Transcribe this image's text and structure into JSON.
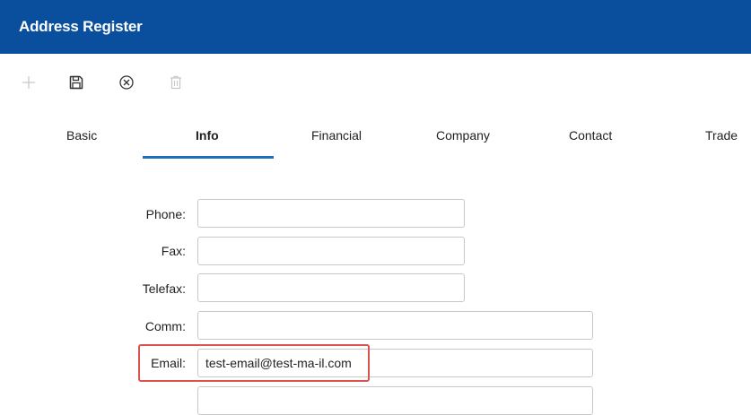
{
  "window": {
    "title": "Address Register"
  },
  "toolbar": {
    "items": [
      {
        "icon": "plus-icon",
        "enabled": false
      },
      {
        "icon": "save-icon",
        "enabled": true
      },
      {
        "icon": "cancel-icon",
        "enabled": true
      },
      {
        "icon": "delete-icon",
        "enabled": false
      }
    ]
  },
  "tabs": [
    {
      "label": "Basic",
      "active": false
    },
    {
      "label": "Info",
      "active": true
    },
    {
      "label": "Financial",
      "active": false
    },
    {
      "label": "Company",
      "active": false
    },
    {
      "label": "Contact",
      "active": false
    },
    {
      "label": "Trade",
      "active": false
    }
  ],
  "form": {
    "phone": {
      "label": "Phone:",
      "value": ""
    },
    "fax": {
      "label": "Fax:",
      "value": ""
    },
    "telefax": {
      "label": "Telefax:",
      "value": ""
    },
    "comm": {
      "label": "Comm:",
      "value": ""
    },
    "email": {
      "label": "Email:",
      "value": "test-email@test-ma-il.com"
    }
  },
  "colors": {
    "titlebar": "#0a4f9e",
    "tab_underline": "#1f6fc0",
    "highlight": "#d9534f"
  }
}
